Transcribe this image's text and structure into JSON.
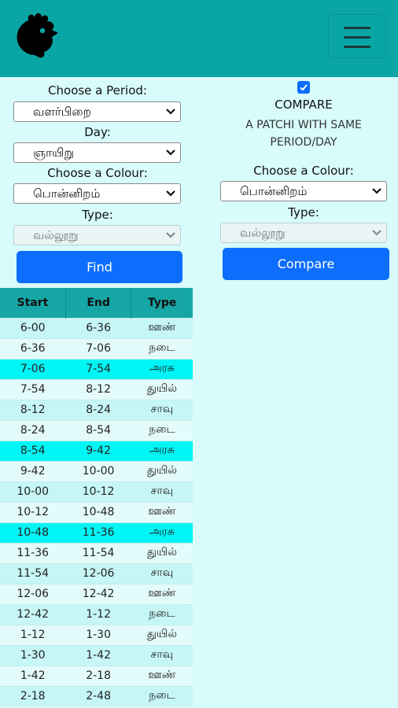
{
  "colors": {
    "navbar": "#0aa6a6",
    "background": "#d8fbfb",
    "primary_button": "#0d6efd",
    "table_header": "#17a6a6",
    "highlight_row": "#00f5f5"
  },
  "navbar": {
    "logo_icon": "rooster-head-icon",
    "menu_icon": "hamburger-menu-icon"
  },
  "form": {
    "period_label": "Choose a Period:",
    "period_value": "வளர்பிறை",
    "day_label": "Day:",
    "day_value": "ஞாயிறு",
    "colour_label": "Choose a Colour:",
    "colour_value": "பொன்னிறம்",
    "type_label": "Type:",
    "type_value": "வல்லூறு",
    "find_button": "Find"
  },
  "compare": {
    "checked": true,
    "title": "COMPARE",
    "subtitle": "A PATCHI WITH SAME PERIOD/DAY",
    "colour_label": "Choose a Colour:",
    "colour_value": "பொன்னிறம்",
    "type_label": "Type:",
    "type_value": "வல்லூறு",
    "compare_button": "Compare"
  },
  "table": {
    "headers": [
      "Start",
      "End",
      "Type"
    ],
    "rows": [
      {
        "start": "6-00",
        "end": "6-36",
        "type": "ஊண்",
        "highlight": false
      },
      {
        "start": "6-36",
        "end": "7-06",
        "type": "நடை",
        "highlight": false
      },
      {
        "start": "7-06",
        "end": "7-54",
        "type": "அரசு",
        "highlight": true
      },
      {
        "start": "7-54",
        "end": "8-12",
        "type": "துயில்",
        "highlight": false
      },
      {
        "start": "8-12",
        "end": "8-24",
        "type": "சாவு",
        "highlight": false
      },
      {
        "start": "8-24",
        "end": "8-54",
        "type": "நடை",
        "highlight": false
      },
      {
        "start": "8-54",
        "end": "9-42",
        "type": "அரசு",
        "highlight": true
      },
      {
        "start": "9-42",
        "end": "10-00",
        "type": "துயில்",
        "highlight": false
      },
      {
        "start": "10-00",
        "end": "10-12",
        "type": "சாவு",
        "highlight": false
      },
      {
        "start": "10-12",
        "end": "10-48",
        "type": "ஊண்",
        "highlight": false
      },
      {
        "start": "10-48",
        "end": "11-36",
        "type": "அரசு",
        "highlight": true
      },
      {
        "start": "11-36",
        "end": "11-54",
        "type": "துயில்",
        "highlight": false
      },
      {
        "start": "11-54",
        "end": "12-06",
        "type": "சாவு",
        "highlight": false
      },
      {
        "start": "12-06",
        "end": "12-42",
        "type": "ஊண்",
        "highlight": false
      },
      {
        "start": "12-42",
        "end": "1-12",
        "type": "நடை",
        "highlight": false
      },
      {
        "start": "1-12",
        "end": "1-30",
        "type": "துயில்",
        "highlight": false
      },
      {
        "start": "1-30",
        "end": "1-42",
        "type": "சாவு",
        "highlight": false
      },
      {
        "start": "1-42",
        "end": "2-18",
        "type": "ஊண்",
        "highlight": false
      },
      {
        "start": "2-18",
        "end": "2-48",
        "type": "நடை",
        "highlight": false
      }
    ]
  }
}
